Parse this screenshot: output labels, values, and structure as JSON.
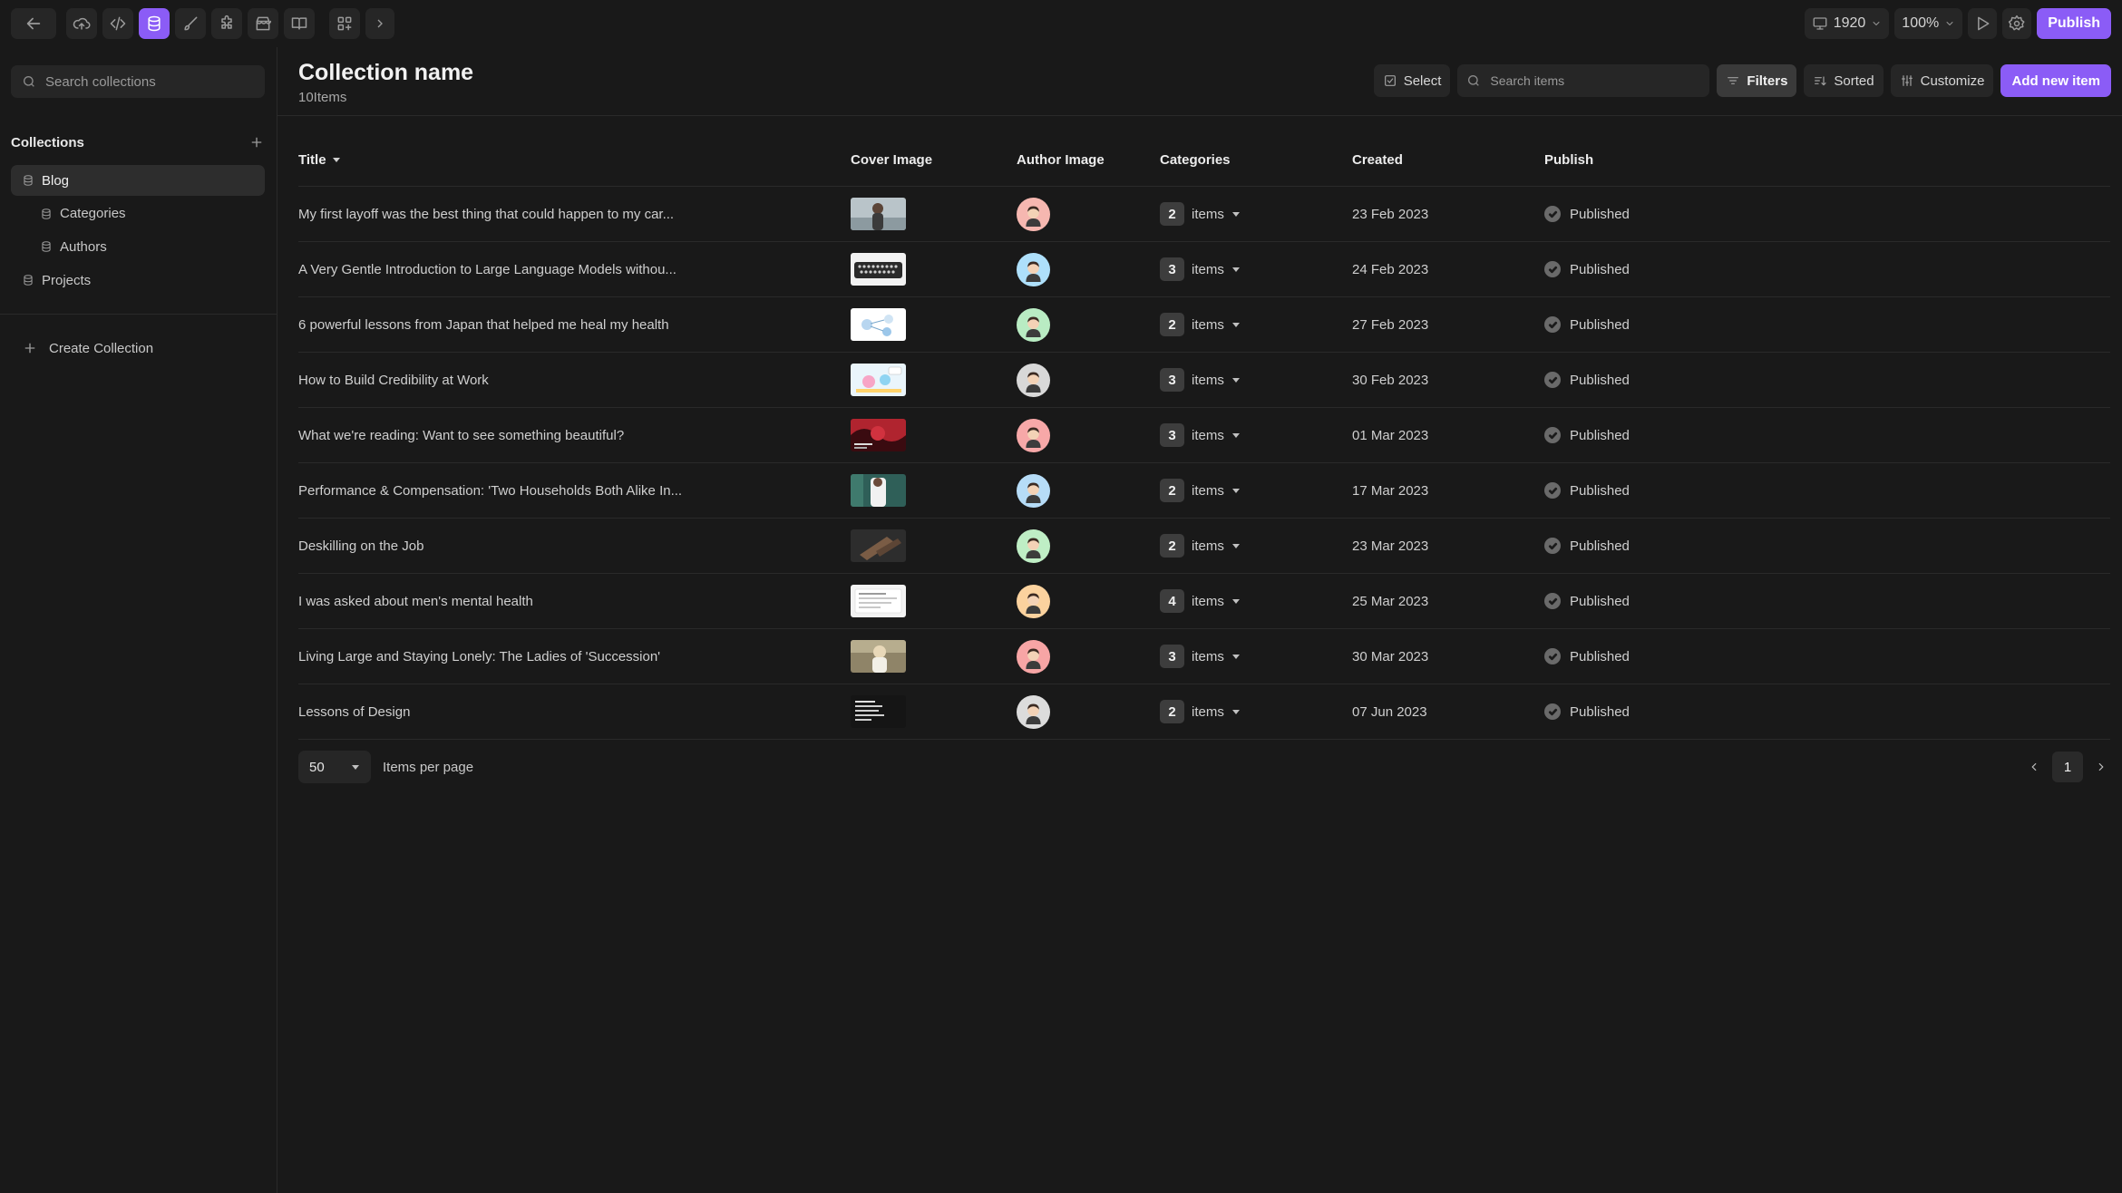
{
  "toolbar": {
    "viewport_label": "1920",
    "zoom_label": "100%",
    "publish_label": "Publish",
    "tools": [
      "cloud-icon",
      "code-icon",
      "database-icon",
      "brush-icon",
      "puzzle-icon",
      "store-icon",
      "book-icon",
      "components-icon"
    ],
    "active_tool": "database-icon",
    "accent_color": "#8b5cf6"
  },
  "sidebar": {
    "search_placeholder": "Search collections",
    "heading": "Collections",
    "items": [
      {
        "label": "Blog",
        "active": true,
        "child": false
      },
      {
        "label": "Categories",
        "active": false,
        "child": true
      },
      {
        "label": "Authors",
        "active": false,
        "child": true
      },
      {
        "label": "Projects",
        "active": false,
        "child": false
      }
    ],
    "create_label": "Create Collection"
  },
  "main": {
    "title": "Collection name",
    "count": "10Items",
    "actions": {
      "select": "Select",
      "search_placeholder": "Search items",
      "filters": "Filters",
      "sorted": "Sorted",
      "customize": "Customize",
      "add_new": "Add new item"
    },
    "columns": {
      "title": "Title",
      "cover": "Cover Image",
      "author": "Author Image",
      "categories": "Categories",
      "created": "Created",
      "publish": "Publish"
    },
    "rows": [
      {
        "title": "My first layoff was the best thing that could happen to my car...",
        "cover": "portrait",
        "author_bg": "#f6b7b0",
        "cats": "2",
        "cats_label": "items",
        "created": "23 Feb 2023",
        "status": "Published"
      },
      {
        "title": "A Very Gentle Introduction to Large Language Models withou...",
        "cover": "typewriter",
        "author_bg": "#aee0fb",
        "cats": "3",
        "cats_label": "items",
        "created": "24 Feb 2023",
        "status": "Published"
      },
      {
        "title": "6 powerful lessons from Japan that helped me heal my health",
        "cover": "diagram",
        "author_bg": "#b9ecc3",
        "cats": "2",
        "cats_label": "items",
        "created": "27 Feb 2023",
        "status": "Published"
      },
      {
        "title": "How to Build Credibility at Work",
        "cover": "illustration",
        "author_bg": "#d8d8d8",
        "cats": "3",
        "cats_label": "items",
        "created": "30 Feb 2023",
        "status": "Published"
      },
      {
        "title": "What we're reading: Want to see something beautiful?",
        "cover": "red",
        "author_bg": "#f7a8a8",
        "cats": "3",
        "cats_label": "items",
        "created": "01 Mar 2023",
        "status": "Published"
      },
      {
        "title": "Performance & Compensation: 'Two Households Both Alike In...",
        "cover": "green",
        "author_bg": "#b6dcf7",
        "cats": "2",
        "cats_label": "items",
        "created": "17 Mar 2023",
        "status": "Published"
      },
      {
        "title": "Deskilling on the Job",
        "cover": "dark",
        "author_bg": "#bfeec5",
        "cats": "2",
        "cats_label": "items",
        "created": "23 Mar 2023",
        "status": "Published"
      },
      {
        "title": "I was asked about men's mental health",
        "cover": "document",
        "author_bg": "#fbd29e",
        "cats": "4",
        "cats_label": "items",
        "created": "25 Mar 2023",
        "status": "Published"
      },
      {
        "title": "Living Large and Staying Lonely: The Ladies of 'Succession'",
        "cover": "photo",
        "author_bg": "#f7a5a5",
        "cats": "3",
        "cats_label": "items",
        "created": "30 Mar 2023",
        "status": "Published"
      },
      {
        "title": "Lessons of Design",
        "cover": "text",
        "author_bg": "#dcdcdc",
        "cats": "2",
        "cats_label": "items",
        "created": "07 Jun 2023",
        "status": "Published"
      }
    ]
  },
  "pagination": {
    "per_page": "50",
    "per_page_label": "Items per page",
    "current_page": "1"
  }
}
